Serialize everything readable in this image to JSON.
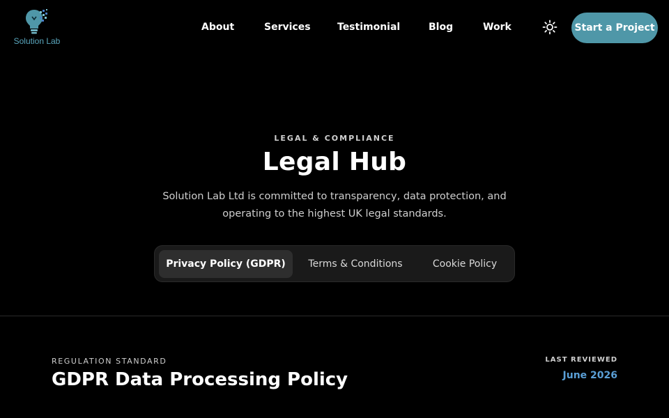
{
  "header": {
    "logo_text": "Solution Lab",
    "nav": [
      {
        "label": "About"
      },
      {
        "label": "Services"
      },
      {
        "label": "Testimonial"
      },
      {
        "label": "Blog"
      },
      {
        "label": "Work"
      }
    ],
    "theme_icon": "sun-icon",
    "cta_label": "Start a Project"
  },
  "hero": {
    "eyebrow": "LEGAL & COMPLIANCE",
    "title": "Legal Hub",
    "subtitle": "Solution Lab Ltd is committed to transparency, data protection, and operating to the highest UK legal standards.",
    "tabs": [
      {
        "label": "Privacy Policy (GDPR)",
        "active": true
      },
      {
        "label": "Terms & Conditions",
        "active": false
      },
      {
        "label": "Cookie Policy",
        "active": false
      }
    ]
  },
  "section": {
    "regulation_label": "REGULATION STANDARD",
    "regulation_title": "GDPR Data Processing Policy",
    "review_label": "LAST REVIEWED",
    "review_date": "June 2026"
  },
  "colors": {
    "background": "#000000",
    "accent": "#4f97a8",
    "logo_text": "#5aa6bd",
    "date": "#5a9fd6",
    "tab_bar": "#1a1a1a",
    "tab_active": "#2e2e2e"
  }
}
